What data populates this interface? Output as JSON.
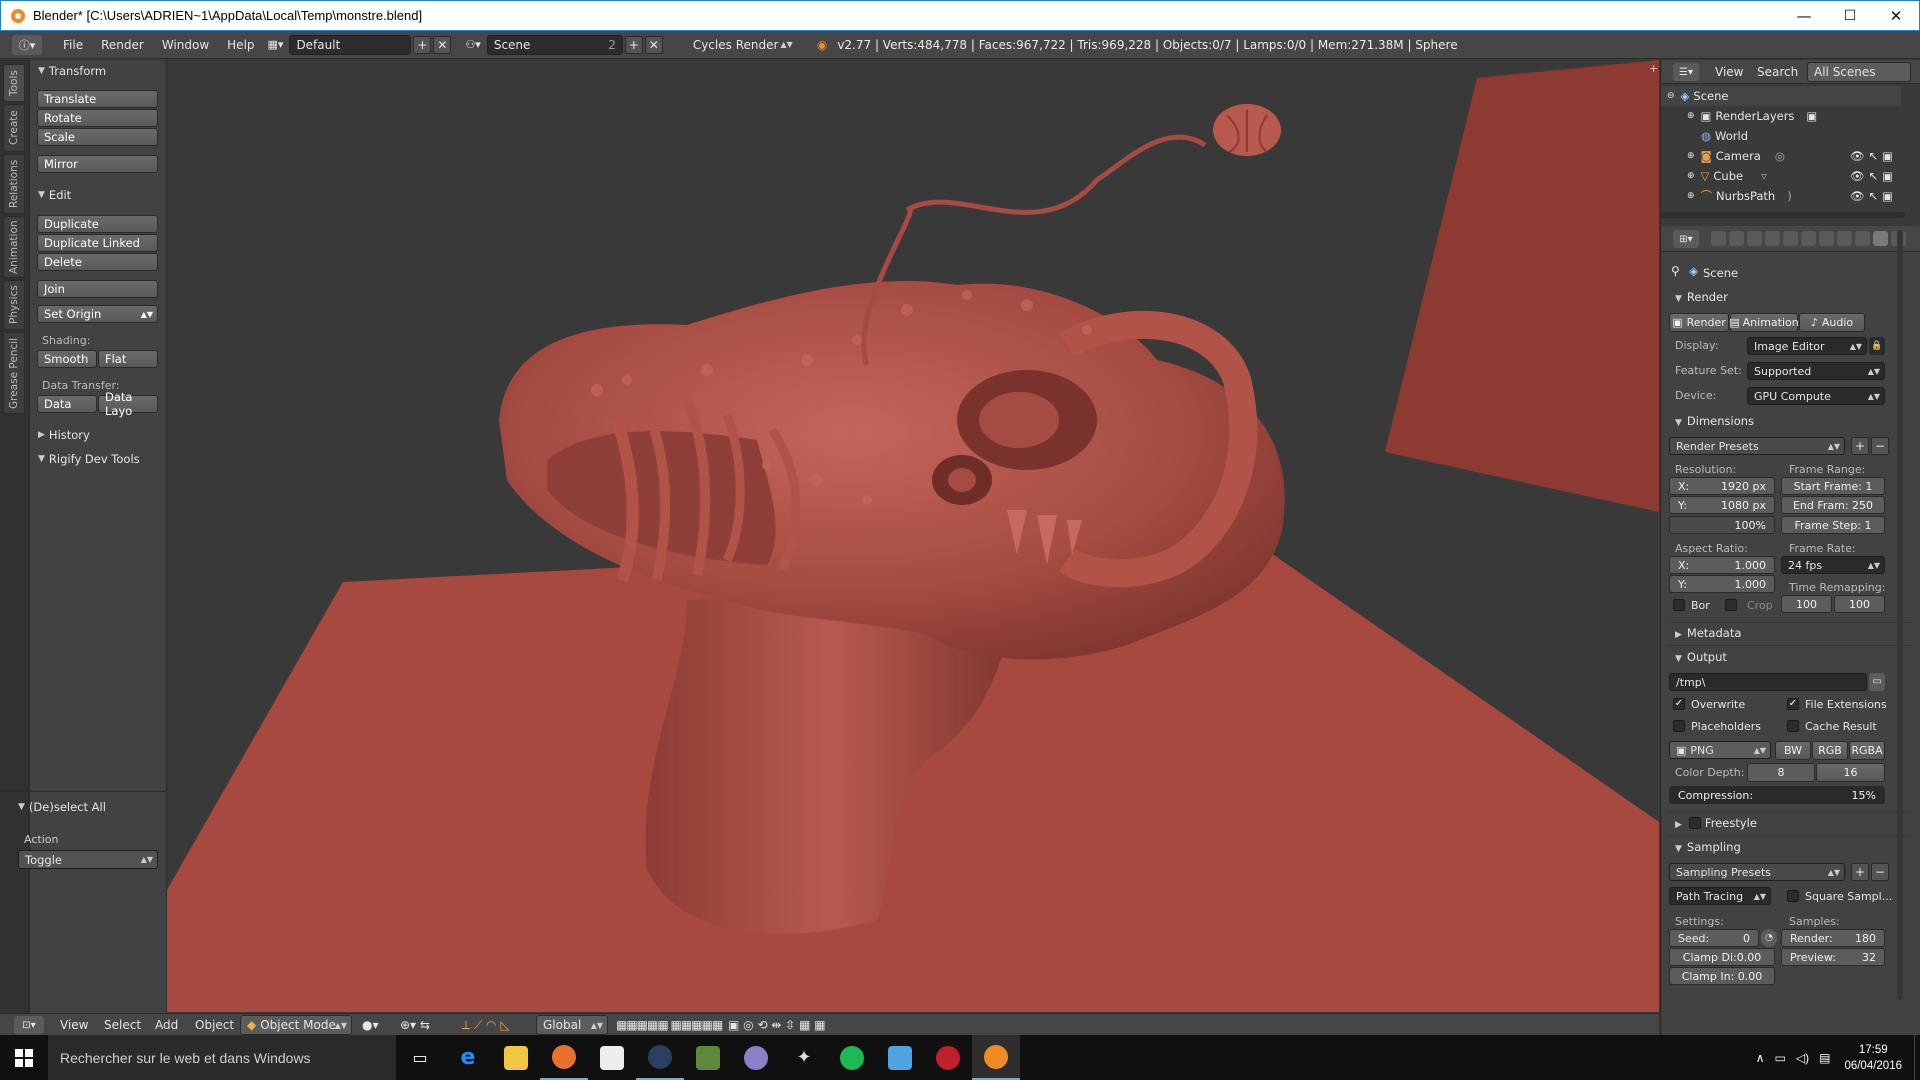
{
  "window": {
    "title": "Blender* [C:\\Users\\ADRIEN~1\\AppData\\Local\\Temp\\monstre.blend]",
    "minimize": "—",
    "maximize": "☐",
    "close": "✕"
  },
  "infobar": {
    "menus": [
      "File",
      "Render",
      "Window",
      "Help"
    ],
    "layout": "Default",
    "scene": "Scene",
    "scene_users": "2",
    "engine": "Cycles Render",
    "stats": "v2.77 | Verts:484,778 | Faces:967,722 | Tris:969,228 | Objects:0/7 | Lamps:0/0 | Mem:271.38M | Sphere"
  },
  "tabs": [
    "Tools",
    "Create",
    "Relations",
    "Animation",
    "Physics",
    "Grease Pencil"
  ],
  "toolshelf": {
    "transform_header": "Transform",
    "translate": "Translate",
    "rotate": "Rotate",
    "scale": "Scale",
    "mirror": "Mirror",
    "edit_header": "Edit",
    "duplicate": "Duplicate",
    "duplicate_linked": "Duplicate Linked",
    "delete": "Delete",
    "join": "Join",
    "set_origin": "Set Origin",
    "shading_label": "Shading:",
    "smooth": "Smooth",
    "flat": "Flat",
    "data_transfer_label": "Data Transfer:",
    "data": "Data",
    "data_layo": "Data Layo",
    "history": "History",
    "rigify": "Rigify Dev Tools",
    "operator_header": "(De)select All",
    "action_label": "Action",
    "action_value": "Toggle"
  },
  "viewport_header": {
    "view": "View",
    "select": "Select",
    "add": "Add",
    "object": "Object",
    "mode": "Object Mode",
    "orientation": "Global"
  },
  "outliner": {
    "view": "View",
    "search": "Search",
    "filter": "All Scenes",
    "items": [
      {
        "label": "Scene",
        "depth": 0
      },
      {
        "label": "RenderLayers",
        "depth": 1
      },
      {
        "label": "World",
        "depth": 1
      },
      {
        "label": "Camera",
        "depth": 1
      },
      {
        "label": "Cube",
        "depth": 1
      },
      {
        "label": "NurbsPath",
        "depth": 1
      }
    ]
  },
  "properties": {
    "context": "Scene",
    "render_header": "Render",
    "render_btn": "Render",
    "animation_btn": "Animation",
    "audio_btn": "Audio",
    "display_label": "Display:",
    "display_value": "Image Editor",
    "feature_label": "Feature Set:",
    "feature_value": "Supported",
    "device_label": "Device:",
    "device_value": "GPU Compute",
    "dimensions_header": "Dimensions",
    "render_presets": "Render Presets",
    "resolution_label": "Resolution:",
    "res_x_label": "X:",
    "res_x": "1920 px",
    "res_y_label": "Y:",
    "res_y": "1080 px",
    "res_pct": "100%",
    "frame_range_label": "Frame Range:",
    "start_frame": "Start Frame: 1",
    "end_frame": "End Fram: 250",
    "frame_step": "Frame Step: 1",
    "aspect_label": "Aspect Ratio:",
    "aspect_x_label": "X:",
    "aspect_x": "1.000",
    "aspect_y_label": "Y:",
    "aspect_y": "1.000",
    "frame_rate_label": "Frame Rate:",
    "frame_rate": "24 fps",
    "time_remap_label": "Time Remapping:",
    "remap_old": "100",
    "remap_new": "100",
    "bor": "Bor",
    "crop": "Crop",
    "metadata_header": "Metadata",
    "output_header": "Output",
    "output_path": "/tmp\\",
    "overwrite": "Overwrite",
    "file_ext": "File Extensions",
    "placeholders": "Placeholders",
    "cache_result": "Cache Result",
    "format": "PNG",
    "bw": "BW",
    "rgb": "RGB",
    "rgba": "RGBA",
    "color_depth_label": "Color Depth:",
    "cd8": "8",
    "cd16": "16",
    "compression_label": "Compression:",
    "compression": "15%",
    "freestyle_header": "Freestyle",
    "sampling_header": "Sampling",
    "sampling_presets": "Sampling Presets",
    "integrator": "Path Tracing",
    "square": "Square Sampl...",
    "settings_label": "Settings:",
    "samples_label": "Samples:",
    "seed_label": "Seed:",
    "seed": "0",
    "render_samples_label": "Render:",
    "render_samples": "180",
    "clamp_direct": "Clamp Di:0.00",
    "preview_label": "Preview:",
    "preview_samples": "32",
    "clamp_indirect": "Clamp In: 0.00"
  },
  "taskbar": {
    "search": "Rechercher sur le web et dans Windows",
    "time": "17:59",
    "date": "06/04/2016"
  },
  "colors": {
    "floor": "#a64a40",
    "sculpt": "#b5574b",
    "ui_bg": "#424242",
    "header": "#464646",
    "accent": "#1883d7"
  }
}
